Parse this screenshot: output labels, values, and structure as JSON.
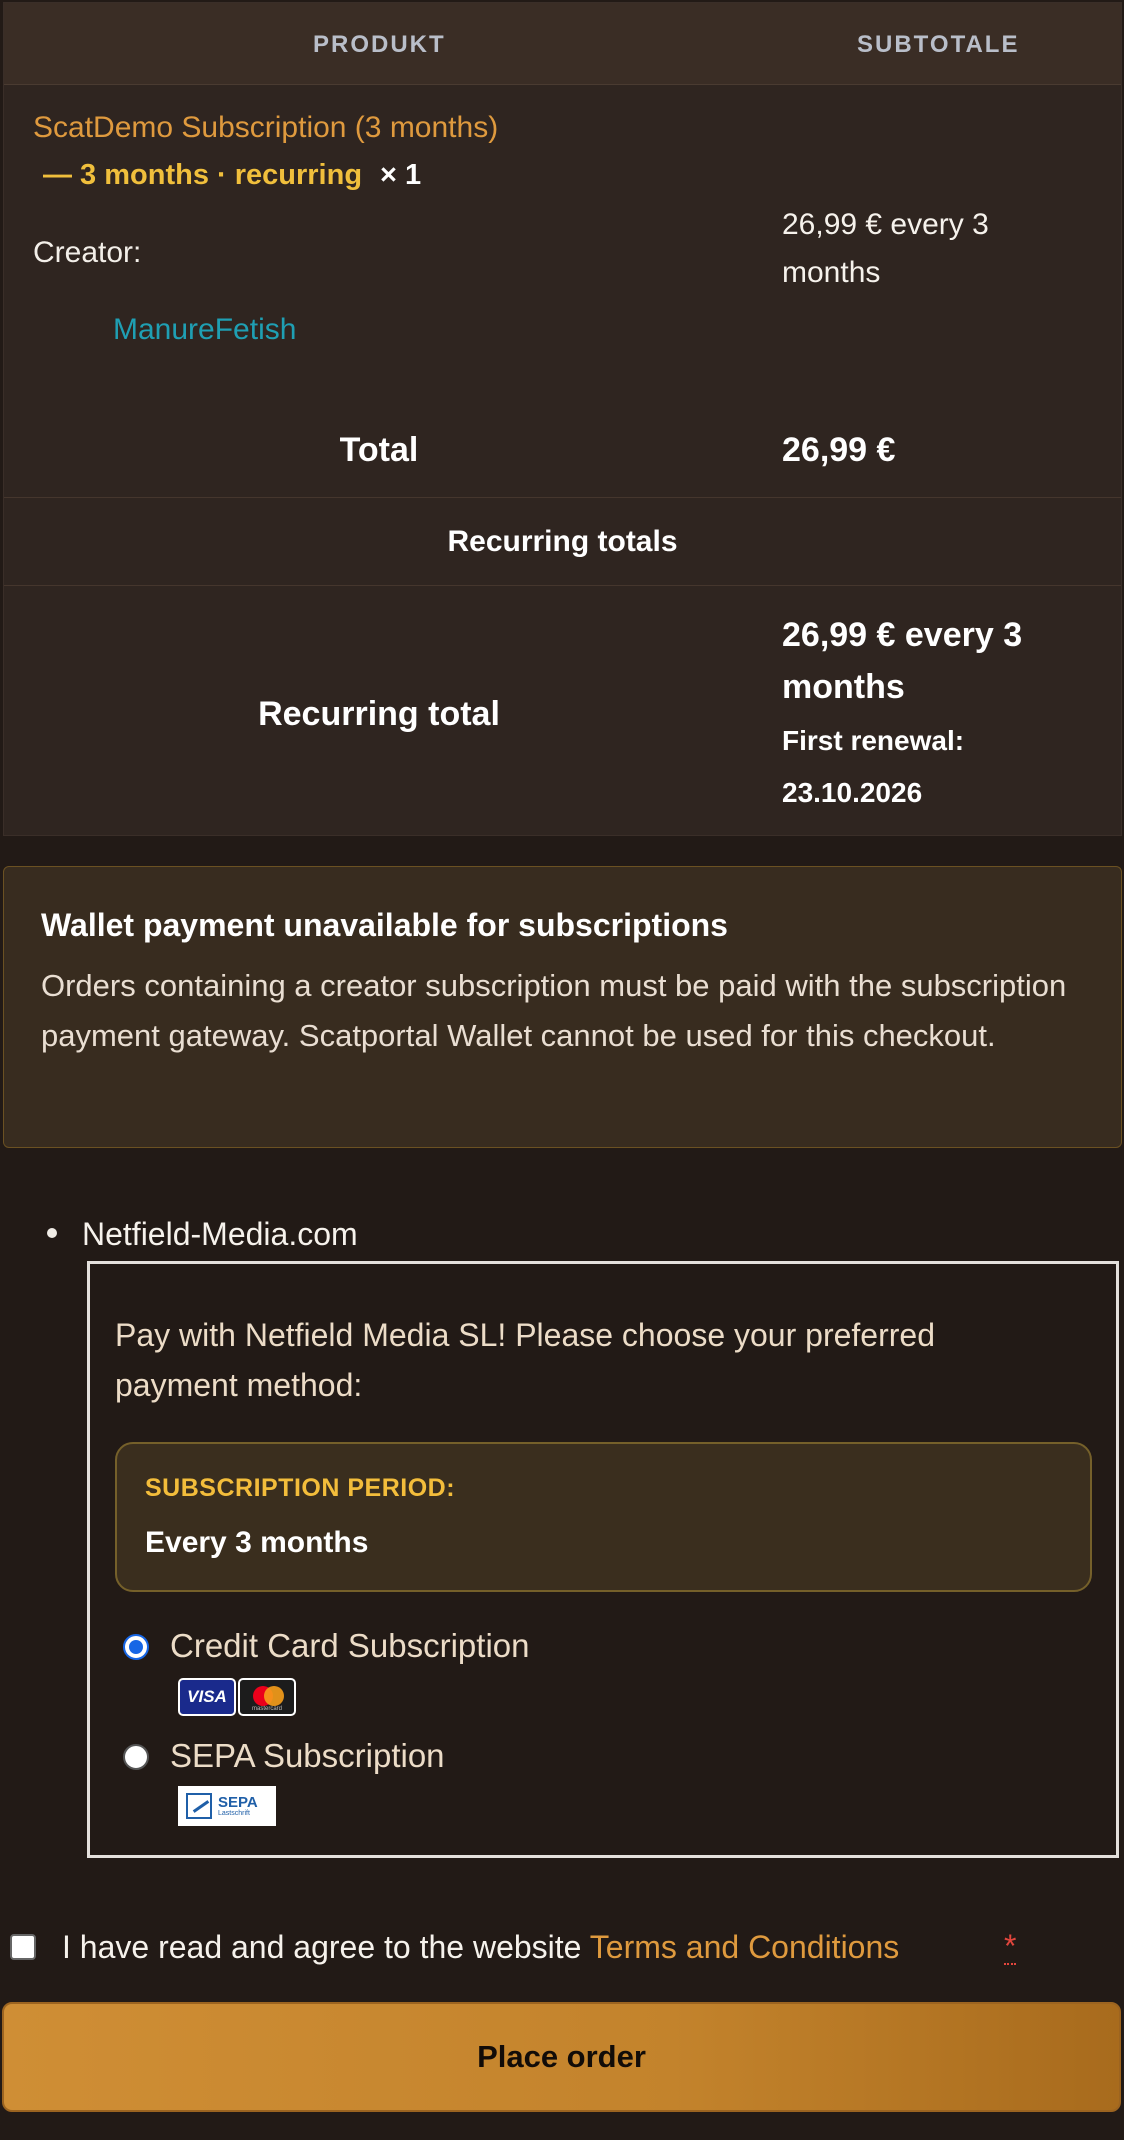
{
  "table": {
    "header_product": "PRODUKT",
    "header_subtotal": "SUBTOTALE",
    "item": {
      "name": "ScatDemo Subscription (3 months)",
      "variant": "— 3 months · recurring",
      "quantity": "× 1",
      "creator_label": "Creator:",
      "creator_name": "ManureFetish",
      "subtotal": "26,99 € every 3 months"
    },
    "total_label": "Total",
    "total_value": "26,99 €",
    "recurring_heading": "Recurring totals",
    "recurring_label": "Recurring total",
    "recurring_value": "26,99 € every 3 months",
    "first_renewal": "First renewal: 23.10.2026"
  },
  "notice": {
    "title": "Wallet payment unavailable for subscriptions",
    "text": "Orders containing a creator subscription must be paid with the subscription payment gateway. Scatportal Wallet cannot be used for this checkout."
  },
  "gateway": {
    "name": "Netfield-Media.com",
    "description": "Pay with Netfield Media SL! Please choose your preferred payment method:",
    "period_label": "SUBSCRIPTION PERIOD:",
    "period_value": "Every 3 months",
    "methods": [
      {
        "label": "Credit Card Subscription",
        "selected": true,
        "logos": [
          "visa-logo",
          "mastercard-logo"
        ]
      },
      {
        "label": "SEPA Subscription",
        "selected": false,
        "logos": [
          "sepa-lastschrift-logo"
        ]
      }
    ],
    "visa_text": "VISA",
    "mastercard_text": "mastercard",
    "sepa_text": "SEPA",
    "sepa_subtext": "Lastschrift"
  },
  "terms": {
    "text": "I have read and agree to the website",
    "link": "Terms and Conditions",
    "required_mark": "*",
    "checked": false
  },
  "place_order_label": "Place order",
  "colors": {
    "accent": "#df9a3e",
    "link": "#1f9fb3",
    "highlight": "#f0bf3c",
    "button": "#c3832c"
  }
}
